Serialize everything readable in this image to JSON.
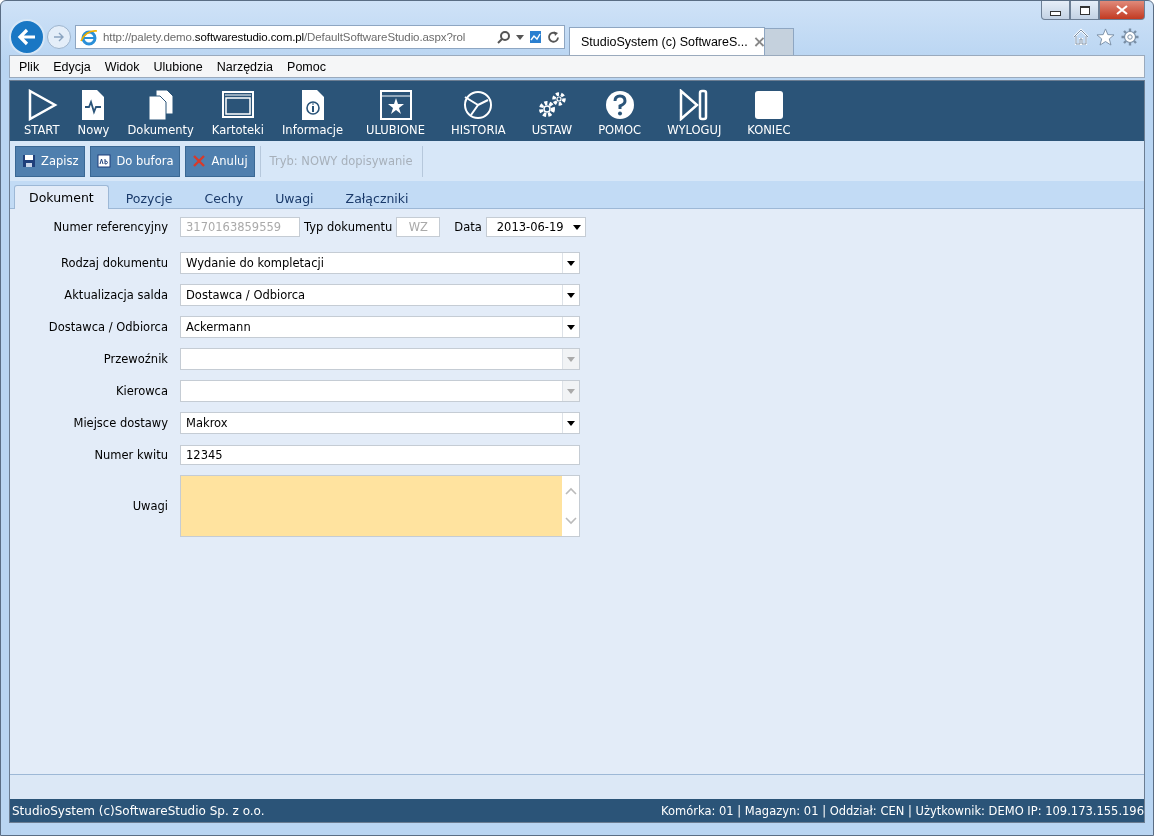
{
  "browser": {
    "url": "http://palety.demo.**softwarestudio.com.pl**/DefaultSoftwareStudio.aspx?rol",
    "tab_title": "StudioSystem (c) SoftwareS...",
    "tab_close": "×"
  },
  "menu_bar": [
    "Plik",
    "Edycja",
    "Widok",
    "Ulubione",
    "Narzędzia",
    "Pomoc"
  ],
  "toolbar": [
    {
      "label": "START",
      "kind": "play"
    },
    {
      "label": "Nowy",
      "kind": "new"
    },
    {
      "label": "Dokumenty",
      "kind": "docs"
    },
    {
      "label": "Kartoteki",
      "kind": "screen"
    },
    {
      "label": "Informacje",
      "kind": "info"
    },
    {
      "label": "ULUBIONE",
      "kind": "star"
    },
    {
      "label": "HISTORIA",
      "kind": "history"
    },
    {
      "label": "USTAW",
      "kind": "gears"
    },
    {
      "label": "POMOC",
      "kind": "help"
    },
    {
      "label": "WYLOGUJ",
      "kind": "logout"
    },
    {
      "label": "KONIEC",
      "kind": "end"
    }
  ],
  "actions": [
    {
      "label": "Zapisz",
      "kind": "save"
    },
    {
      "label": "Do bufora",
      "kind": "buffer"
    },
    {
      "label": "Anuluj",
      "kind": "cancel"
    }
  ],
  "mode": "Tryb: NOWY dopisywanie",
  "tabs": [
    {
      "label": "Dokument",
      "selected": true
    },
    {
      "label": "Pozycje",
      "selected": false
    },
    {
      "label": "Cechy",
      "selected": false
    },
    {
      "label": "Uwagi",
      "selected": false
    },
    {
      "label": "Załączniki",
      "selected": false
    }
  ],
  "header_row": {
    "label": "Numer referencyjny",
    "reference": "3170163859559",
    "type_label": "Typ dokumentu",
    "type": "WZ",
    "date_label": "Data",
    "date": "2013-06-19"
  },
  "fields": [
    {
      "label": "Rodzaj dokumentu",
      "kind": "select",
      "value": "Wydanie do kompletacji",
      "disabled": false
    },
    {
      "label": "Aktualizacja salda",
      "kind": "select",
      "value": "Dostawca / Odbiorca",
      "disabled": false
    },
    {
      "label": "Dostawca / Odbiorca",
      "kind": "select",
      "value": "Ackermann",
      "disabled": false
    },
    {
      "label": "Przewoźnik",
      "kind": "select",
      "disabled": true
    },
    {
      "label": "Kierowca",
      "kind": "select",
      "disabled": true
    },
    {
      "label": "Miejsce dostawy",
      "kind": "select",
      "value": "Makrox",
      "disabled": false
    },
    {
      "label": "Numer kwitu",
      "kind": "text",
      "value": "12345"
    },
    {
      "label": "Uwagi",
      "kind": "textarea"
    }
  ],
  "status_bar": {
    "left": "StudioSystem (c)SoftwareStudio Sp. z o.o.",
    "right": "Komórka: 01 | Magazyn: 01 | Oddział: CEN | Użytkownik: DEMO IP: 109.173.155.196"
  }
}
